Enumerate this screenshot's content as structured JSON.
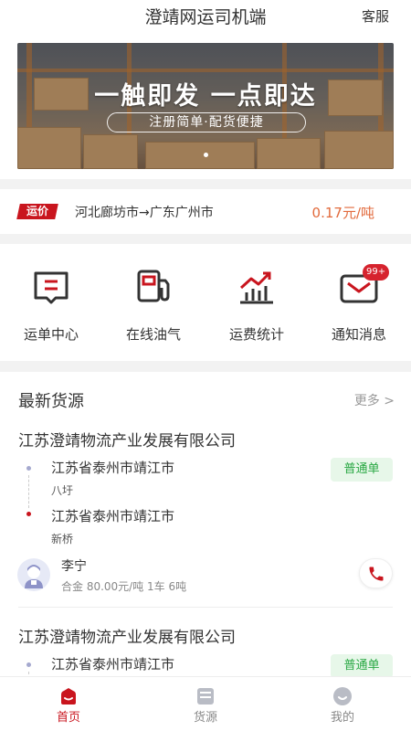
{
  "header": {
    "title": "澄靖网运司机端",
    "service_label": "客服"
  },
  "banner": {
    "headline": "一触即发 一点即达",
    "subline": "注册简单·配货便捷"
  },
  "price_row": {
    "tag": "运价",
    "route": "河北廊坊市→广东广州市",
    "price": "0.17元/吨"
  },
  "menu": {
    "items": [
      {
        "label": "运单中心",
        "icon": "waybill-icon"
      },
      {
        "label": "在线油气",
        "icon": "fuel-pump-icon"
      },
      {
        "label": "运费统计",
        "icon": "bar-chart-icon"
      },
      {
        "label": "通知消息",
        "icon": "envelope-icon",
        "badge": "99+"
      }
    ]
  },
  "cargo": {
    "title": "最新货源",
    "more_label": "更多 >",
    "items": [
      {
        "company": "江苏澄靖物流产业发展有限公司",
        "from": "江苏省泰州市靖江市",
        "from_detail": "八圩",
        "to": "江苏省泰州市靖江市",
        "to_detail": "新桥",
        "type": "普通单",
        "driver": "李宁",
        "detail": "合金 80.00元/吨 1车 6吨"
      },
      {
        "company": "江苏澄靖物流产业发展有限公司",
        "from": "江苏省泰州市靖江市",
        "type": "普通单"
      }
    ]
  },
  "tabbar": {
    "items": [
      {
        "label": "首页",
        "icon": "home-icon",
        "active": true
      },
      {
        "label": "货源",
        "icon": "cargo-icon",
        "active": false
      },
      {
        "label": "我的",
        "icon": "profile-icon",
        "active": false
      }
    ]
  },
  "colors": {
    "brand_red": "#c9151e",
    "price_orange": "#e26a3c",
    "tag_green": "#29a843"
  }
}
